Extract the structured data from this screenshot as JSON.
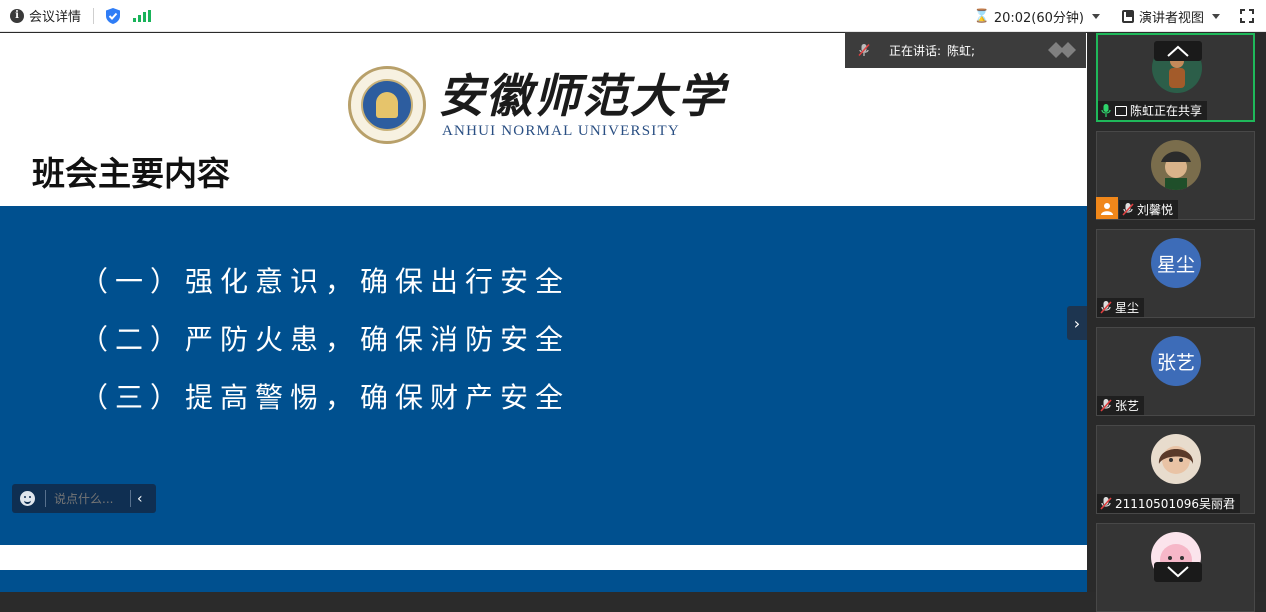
{
  "topbar": {
    "meeting_details_label": "会议详情",
    "timer_text": "20:02(60分钟)",
    "presenter_view_label": "演讲者视图"
  },
  "slide": {
    "university_cn": "安徽师范大学",
    "university_en": "ANHUI NORMAL UNIVERSITY",
    "title": "班会主要内容",
    "points": [
      "（一）强化意识，确保出行安全",
      "（二）严防火患，确保消防安全",
      "（三）提高警惕，确保财产安全"
    ]
  },
  "comment": {
    "placeholder": "说点什么..."
  },
  "speaking": {
    "label": "正在讲话:",
    "name": "陈虹;"
  },
  "participants": [
    {
      "name": "陈虹正在共享",
      "avatar_type": "photo",
      "active": true,
      "mic": "on",
      "sharing": true
    },
    {
      "name": "刘馨悦",
      "avatar_type": "photo",
      "active": false,
      "mic": "muted",
      "host": true
    },
    {
      "name": "星尘",
      "avatar_type": "text",
      "avatar_text": "星尘",
      "active": false,
      "mic": "muted"
    },
    {
      "name": "张艺",
      "avatar_type": "text",
      "avatar_text": "张艺",
      "active": false,
      "mic": "muted"
    },
    {
      "name": "21110501096吴丽君",
      "avatar_type": "photo",
      "active": false,
      "mic": "muted"
    },
    {
      "name": "",
      "avatar_type": "photo",
      "active": false,
      "mic": "muted"
    }
  ],
  "colors": {
    "slide_blue": "#00508f",
    "active_green": "#1fb85a",
    "avatar_blue": "#3d6cb8",
    "host_orange": "#f0871a"
  }
}
